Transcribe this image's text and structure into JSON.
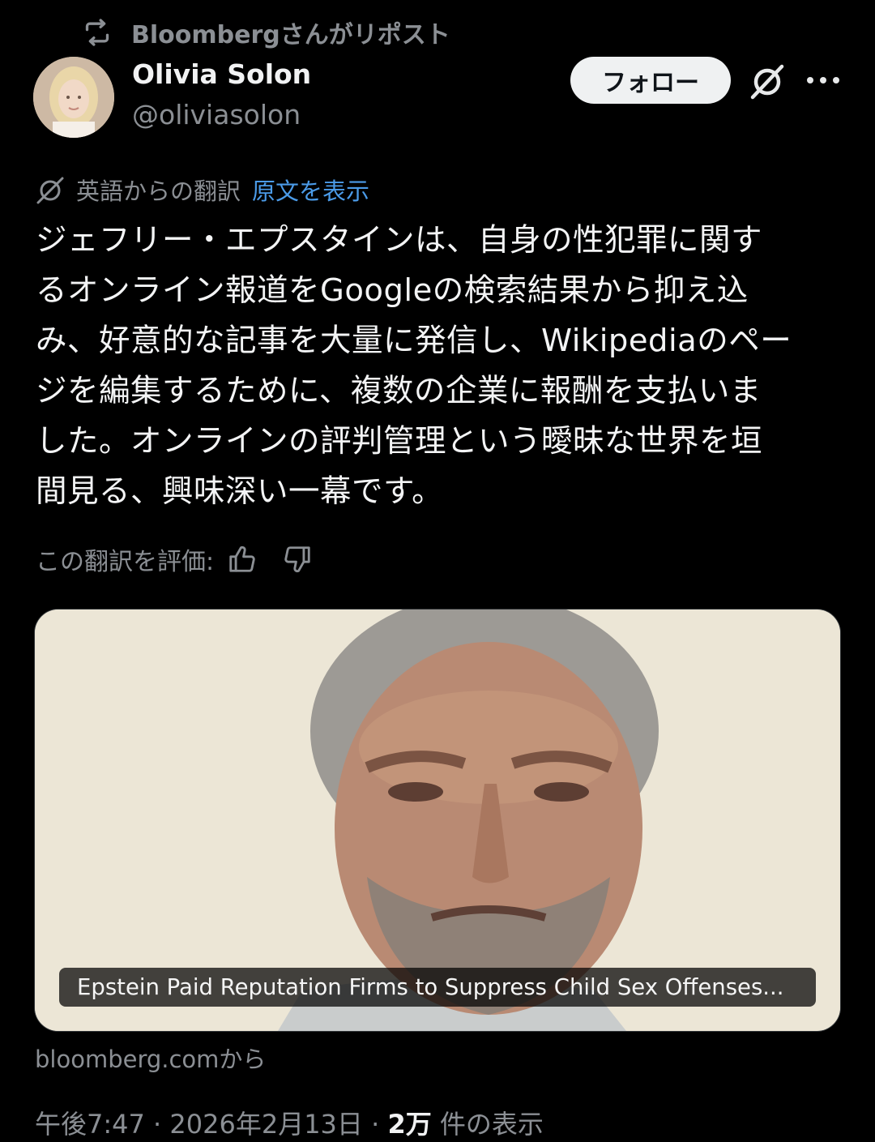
{
  "repost": {
    "text": "Bloombergさんがリポスト",
    "icon": "repost-icon"
  },
  "author": {
    "name": "Olivia Solon",
    "handle": "@oliviasolon",
    "avatar_icon": "avatar"
  },
  "actions": {
    "follow_label": "フォロー",
    "grok_icon": "grok-icon",
    "more_icon": "more-icon"
  },
  "translation": {
    "label": "英語からの翻訳",
    "show_original": "原文を表示",
    "icon": "translate-icon"
  },
  "tweet": {
    "text": "ジェフリー・エプスタインは、自身の性犯罪に関す\nるオンライン報道をGoogleの検索結果から抑え込\nみ、好意的な記事を大量に発信し、Wikipediaのペー\nジを編集するために、複数の企業に報酬を支払いま\nした。オンラインの評判管理という曖昧な世界を垣\n間見る、興味深い一幕です。"
  },
  "rating": {
    "label": "この翻訳を評価:",
    "up_icon": "thumbs-up-icon",
    "down_icon": "thumbs-down-icon"
  },
  "card": {
    "headline": "Epstein Paid Reputation Firms to Suppress Child Sex Offenses...",
    "source": "bloomberg.comから"
  },
  "meta": {
    "time": "午後7:47",
    "date": "2026年2月13日",
    "views_count": "2万",
    "views_label": "件の表示",
    "separator": "·"
  }
}
